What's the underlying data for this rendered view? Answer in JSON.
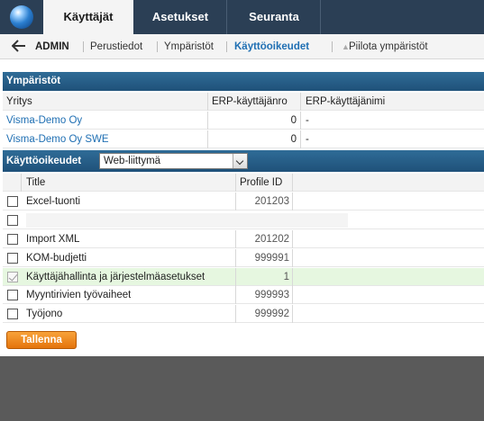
{
  "nav": {
    "tabs": [
      {
        "label": "Käyttäjät",
        "active": true
      },
      {
        "label": "Asetukset",
        "active": false
      },
      {
        "label": "Seuranta",
        "active": false
      }
    ]
  },
  "subnav": {
    "admin_label": "ADMIN",
    "items": [
      "Perustiedot",
      "Ympäristöt",
      "Käyttöoikeudet",
      "Piilota ympäristöt"
    ],
    "active": "Käyttöoikeudet"
  },
  "environments": {
    "title": "Ympäristöt",
    "columns": [
      "Yritys",
      "ERP-käyttäjänro",
      "ERP-käyttäjänimi"
    ],
    "rows": [
      {
        "company": "Visma-Demo Oy",
        "erp_no": "0",
        "erp_name": "-"
      },
      {
        "company": "Visma-Demo Oy SWE",
        "erp_no": "0",
        "erp_name": "-"
      }
    ]
  },
  "permissions": {
    "label": "Käyttöoikeudet",
    "select_value": "Web-liittymä",
    "columns": [
      "Title",
      "Profile ID"
    ],
    "rows": [
      {
        "title": "Excel-tuonti",
        "profile_id": "201203",
        "checked": false,
        "disabled": false
      },
      {
        "title": "",
        "profile_id": "",
        "checked": false,
        "disabled": false
      },
      {
        "title": "Import XML",
        "profile_id": "201202",
        "checked": false,
        "disabled": false
      },
      {
        "title": "KOM-budjetti",
        "profile_id": "999991",
        "checked": false,
        "disabled": false
      },
      {
        "title": "Käyttäjähallinta ja järjestelmäasetukset",
        "profile_id": "1",
        "checked": true,
        "disabled": true
      },
      {
        "title": "Myyntirivien työvaiheet",
        "profile_id": "999993",
        "checked": false,
        "disabled": false
      },
      {
        "title": "Työjono",
        "profile_id": "999992",
        "checked": false,
        "disabled": false
      }
    ]
  },
  "save_button": "Tallenna"
}
